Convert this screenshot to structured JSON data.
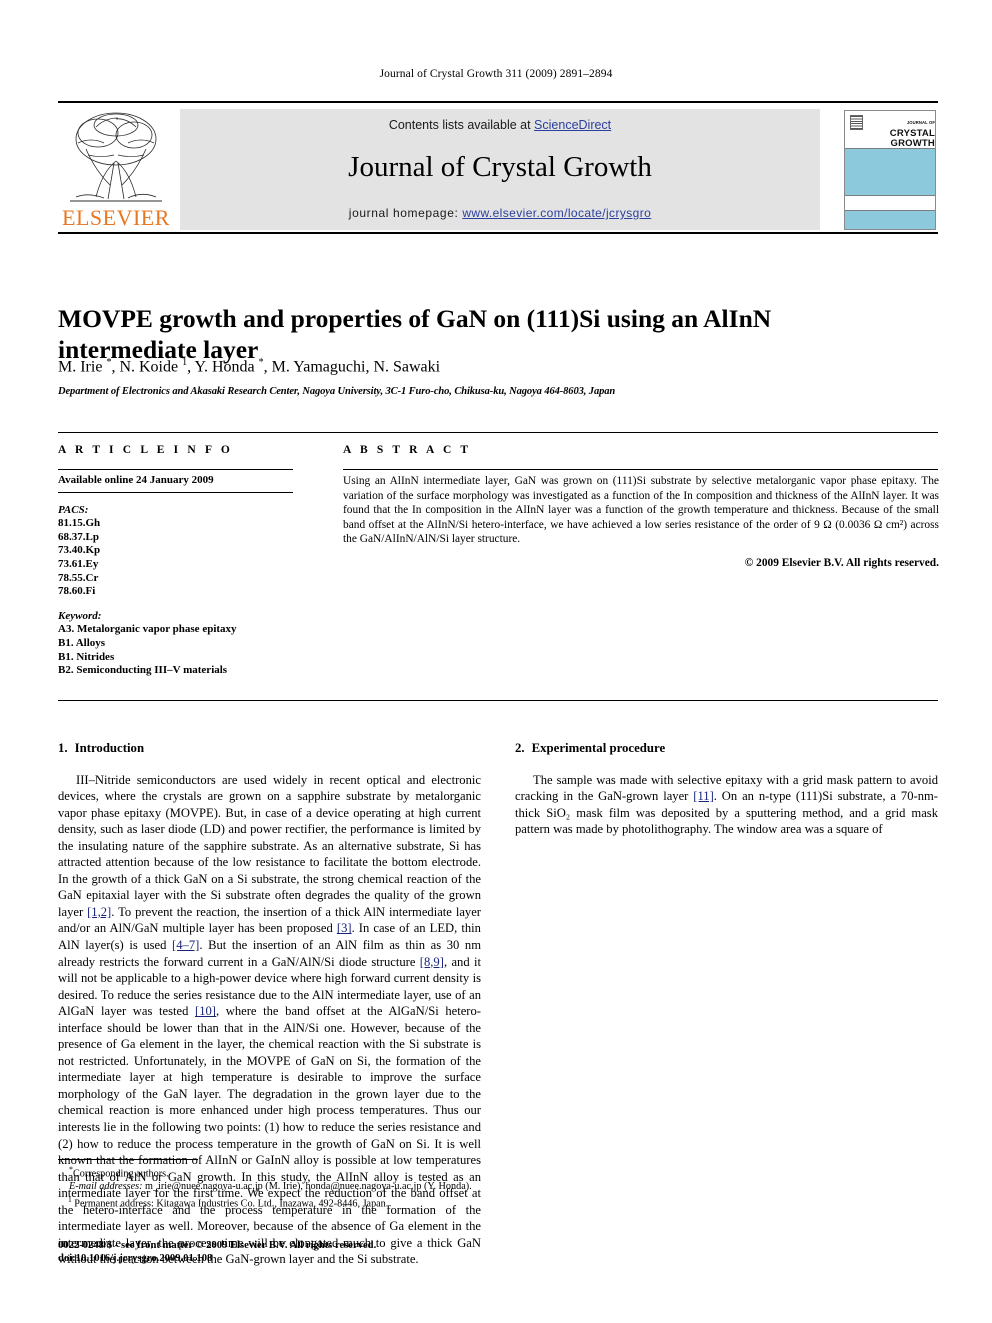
{
  "running_head": "Journal of Crystal Growth 311 (2009) 2891–2894",
  "masthead": {
    "contents_prefix": "Contents lists available at ",
    "sciencedirect": "ScienceDirect",
    "journal_name": "Journal of Crystal Growth",
    "homepage_prefix": "journal homepage: ",
    "homepage_url": "www.elsevier.com/locate/jcrysgro",
    "publisher_wordmark": "ELSEVIER",
    "cover": {
      "line1": "CRYSTAL",
      "line2": "GROWTH",
      "overline": "JOURNAL OF",
      "accent_color": "#8cc9dd"
    },
    "link_color": "#2b3f9c",
    "band_color": "#e3e3e3"
  },
  "article": {
    "title": "MOVPE growth and properties of GaN on (111)Si using an AlInN intermediate layer",
    "authors": "M. Irie *, N. Koide 1, Y. Honda *, M. Yamaguchi, N. Sawaki",
    "affiliation": "Department of Electronics and Akasaki Research Center, Nagoya University, 3C-1 Furo-cho, Chikusa-ku, Nagoya 464-8603, Japan"
  },
  "info": {
    "heading": "A R T I C L E   I N F O",
    "available_online": "Available online 24 January 2009",
    "pacs_label": "PACS:",
    "pacs": [
      "81.15.Gh",
      "68.37.Lp",
      "73.40.Kp",
      "73.61.Ey",
      "78.55.Cr",
      "78.60.Fi"
    ],
    "keyword_label": "Keyword:",
    "keywords": [
      "A3. Metalorganic vapor phase epitaxy",
      "B1. Alloys",
      "B1. Nitrides",
      "B2. Semiconducting III–V materials"
    ]
  },
  "abstract": {
    "heading": "A B S T R A C T",
    "text": "Using an AlInN intermediate layer, GaN was grown on (111)Si substrate by selective metalorganic vapor phase epitaxy. The variation of the surface morphology was investigated as a function of the In composition and thickness of the AlInN layer. It was found that the In composition in the AlInN layer was a function of the growth temperature and thickness. Because of the small band offset at the AlInN/Si hetero-interface, we have achieved a low series resistance of the order of 9 Ω (0.0036 Ω cm²) across the GaN/AlInN/AlN/Si layer structure.",
    "copyright": "© 2009 Elsevier B.V. All rights reserved."
  },
  "sections": {
    "intro": {
      "number": "1.",
      "title": "Introduction",
      "p1_a": "III–Nitride semiconductors are used widely in recent optical and electronic devices, where the crystals are grown on a sapphire substrate by metalorganic vapor phase epitaxy (MOVPE). But, in case of a device operating at high current density, such as laser diode (LD) and power rectifier, the performance is limited by the insulating nature of the sapphire substrate. As an alternative substrate, Si has attracted attention because of the low resistance to facilitate the bottom electrode. In the growth of a thick GaN on a Si substrate, the strong chemical reaction of the GaN epitaxial layer with the Si substrate often degrades the quality of the grown layer ",
      "cite1": "[1,2]",
      "p1_b": ". To prevent the reaction, the insertion of a thick AlN intermediate layer and/or an AlN/GaN multiple layer has been proposed ",
      "cite2": "[3]",
      "p1_c": ". In case of an LED, thin AlN layer(s) is used ",
      "cite3": "[4–7]",
      "p1_d": ". But the insertion of an AlN film as thin as 30 nm already restricts the forward current in a GaN/AlN/Si diode structure ",
      "cite4": "[8,9]",
      "p1_e": ", and it will not be applicable to a high-power device where high forward current density is desired. To reduce the series resistance due to the AlN intermediate layer, use of an AlGaN layer was tested ",
      "cite5": "[10]",
      "p1_f": ", where the band offset at the AlGaN/Si hetero-interface should be lower than that in the AlN/Si one. However, because of the presence of Ga element in the layer, the chemical reaction with the Si substrate is not restricted. Unfortunately, in the MOVPE of GaN on Si, the formation of the intermediate layer at high temperature is desirable to improve the surface morphology of the GaN layer. The degradation in the grown layer due to the chemical reaction is more enhanced under high process temperatures. Thus our interests lie in the following two points: (1) how to reduce the series resistance and (2) how to reduce the process temperature in the growth of GaN on Si. It is well known that the formation of AlInN or GaInN alloy is possible at low temperatures than that of AlN or GaN growth. In this study, the AlInN alloy is tested as an intermediate layer for the first time. We expect the reduction of the band offset at the hetero-interface and the process temperature in the formation of the intermediate layer as well. Moreover, because of the absence of Ga element in the intermediate layer, the process time will be elongated much to give a thick GaN without the reaction between the GaN-grown layer and the Si substrate."
    },
    "experimental": {
      "number": "2.",
      "title": "Experimental procedure",
      "p1_a": "The sample was made with selective epitaxy with a grid mask pattern to avoid cracking in the GaN-grown layer ",
      "cite1": "[11]",
      "p1_b": ". On an n-type (111)Si substrate, a 70-nm-thick SiO₂ mask film was deposited by a sputtering method, and a grid mask pattern was made by photolithography. The window area was a square of"
    }
  },
  "footnotes": {
    "corresponding": "Corresponding authors.",
    "email_label": "E-mail addresses:",
    "emails": " m_irie@nuee.nagoya-u.ac.jp (M. Irie), honda@nuee.nagoya-u.ac.jp (Y. Honda).",
    "permanent_marker": "1",
    "permanent": "Permanent address: Kitagawa Industries Co. Ltd., Inazawa, 492-8446, Japan."
  },
  "imprint": {
    "line1": "0022-0248/$ - see front matter © 2009 Elsevier B.V. All rights reserved.",
    "line2": "doi:10.1016/j.jcrysgro.2009.01.108"
  }
}
